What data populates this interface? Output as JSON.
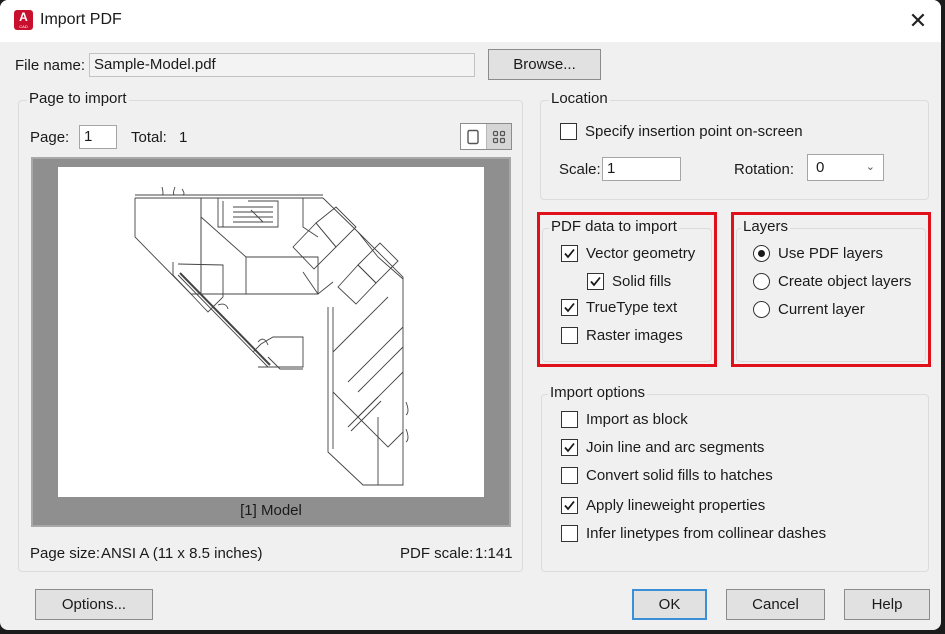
{
  "window": {
    "title": "Import PDF",
    "app_icon_letter": "A",
    "app_icon_sub": "CAD",
    "close_glyph": "✕"
  },
  "file": {
    "label": "File name:",
    "value": "Sample-Model.pdf",
    "browse_label": "Browse..."
  },
  "page_to_import": {
    "title": "Page to import",
    "page_label": "Page:",
    "page_value": "1",
    "total_label": "Total:",
    "total_value": "1",
    "view_modes": [
      "single-page",
      "thumbnails"
    ],
    "active_view": "thumbnails",
    "preview_caption": "[1] Model",
    "page_size_label": "Page size:",
    "page_size_value": "ANSI A (11 x 8.5 inches)",
    "pdf_scale_label": "PDF scale:",
    "pdf_scale_value": "1:141"
  },
  "location": {
    "title": "Location",
    "specify_insertion": {
      "label": "Specify insertion point on-screen",
      "checked": false
    },
    "scale_label": "Scale:",
    "scale_value": "1",
    "rotation_label": "Rotation:",
    "rotation_value": "0"
  },
  "pdf_data": {
    "title": "PDF data to import",
    "items": [
      {
        "label": "Vector geometry",
        "checked": true
      },
      {
        "label": "Solid fills",
        "checked": true
      },
      {
        "label": "TrueType text",
        "checked": true
      },
      {
        "label": "Raster images",
        "checked": false
      }
    ]
  },
  "layers": {
    "title": "Layers",
    "options": [
      {
        "label": "Use PDF layers",
        "selected": true
      },
      {
        "label": "Create object layers",
        "selected": false
      },
      {
        "label": "Current layer",
        "selected": false
      }
    ]
  },
  "import_options": {
    "title": "Import options",
    "items": [
      {
        "label": "Import as block",
        "checked": false
      },
      {
        "label": "Join line and arc segments",
        "checked": true
      },
      {
        "label": "Convert solid fills to hatches",
        "checked": false
      },
      {
        "label": "Apply lineweight properties",
        "checked": true
      },
      {
        "label": "Infer linetypes from collinear dashes",
        "checked": false
      }
    ]
  },
  "buttons": {
    "options": "Options...",
    "ok": "OK",
    "cancel": "Cancel",
    "help": "Help"
  },
  "colors": {
    "highlight": "#e0101a",
    "default_button_border": "#3a8fd6",
    "app_icon": "#c8102e"
  }
}
